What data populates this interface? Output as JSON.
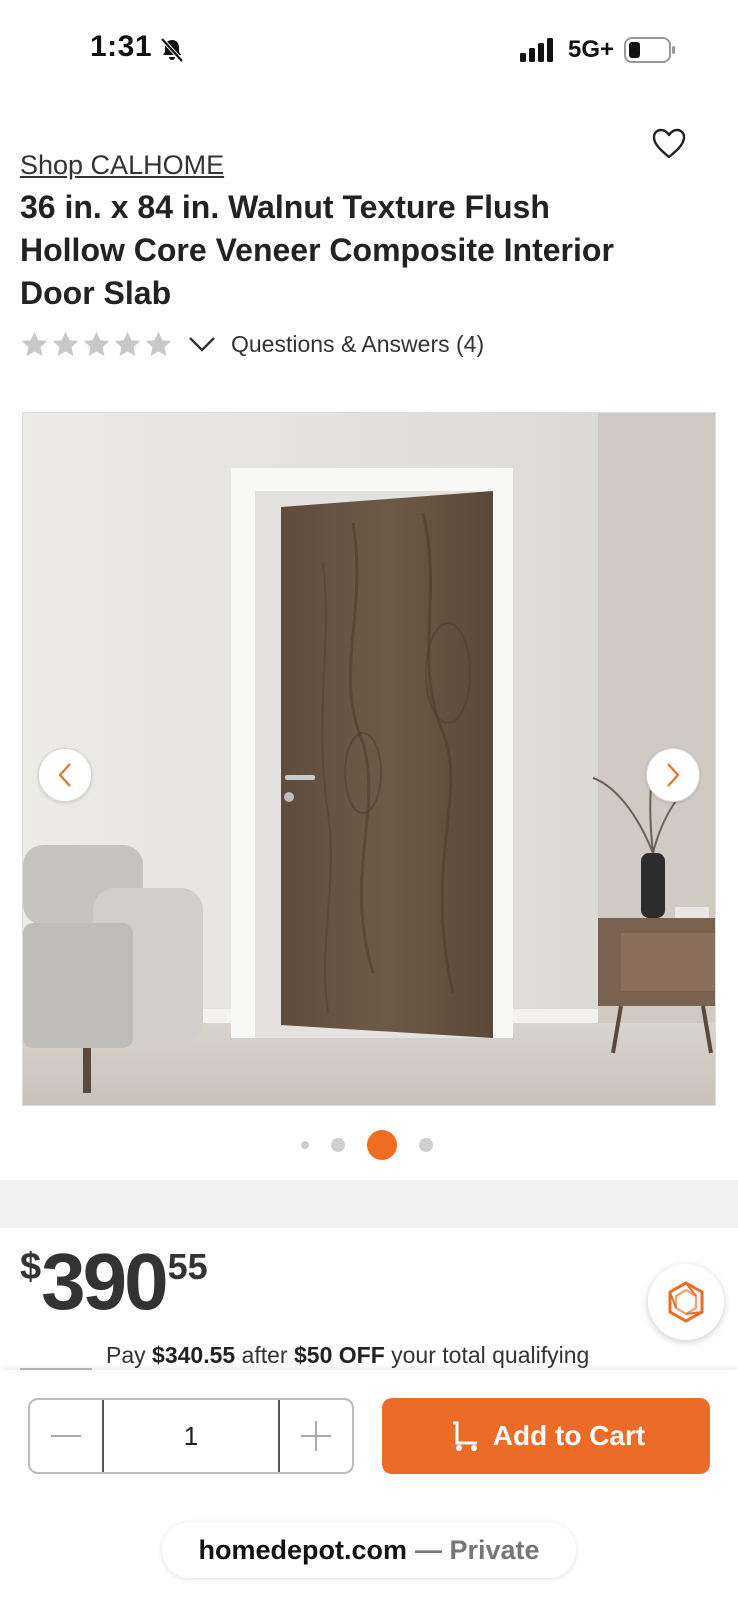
{
  "status_bar": {
    "time": "1:31",
    "network": "5G+",
    "icons": [
      "bell-slash-icon",
      "signal-icon",
      "battery-icon"
    ]
  },
  "product": {
    "brand_link": "Shop CALHOME",
    "title": "36 in. x 84 in. Walnut Texture Flush Hollow Core Veneer Composite Interior Door Slab",
    "rating_stars": 0,
    "rating_max": 5,
    "qa_label": "Questions & Answers (4)"
  },
  "gallery": {
    "image_count": 4,
    "active_index": 2
  },
  "price": {
    "currency": "$",
    "whole": "390",
    "cents": "55"
  },
  "promo": {
    "prefix": "Pay ",
    "amount": "$340.55",
    "middle": " after ",
    "discount": "$50 OFF",
    "suffix": " your total qualifying"
  },
  "cart": {
    "quantity": "1",
    "add_label": "Add to Cart"
  },
  "browser": {
    "domain": "homedepot.com",
    "mode": "— Private"
  },
  "colors": {
    "accent": "#ec6c27",
    "star_empty": "#c8c8c8",
    "background_band": "#f1f1f1"
  }
}
